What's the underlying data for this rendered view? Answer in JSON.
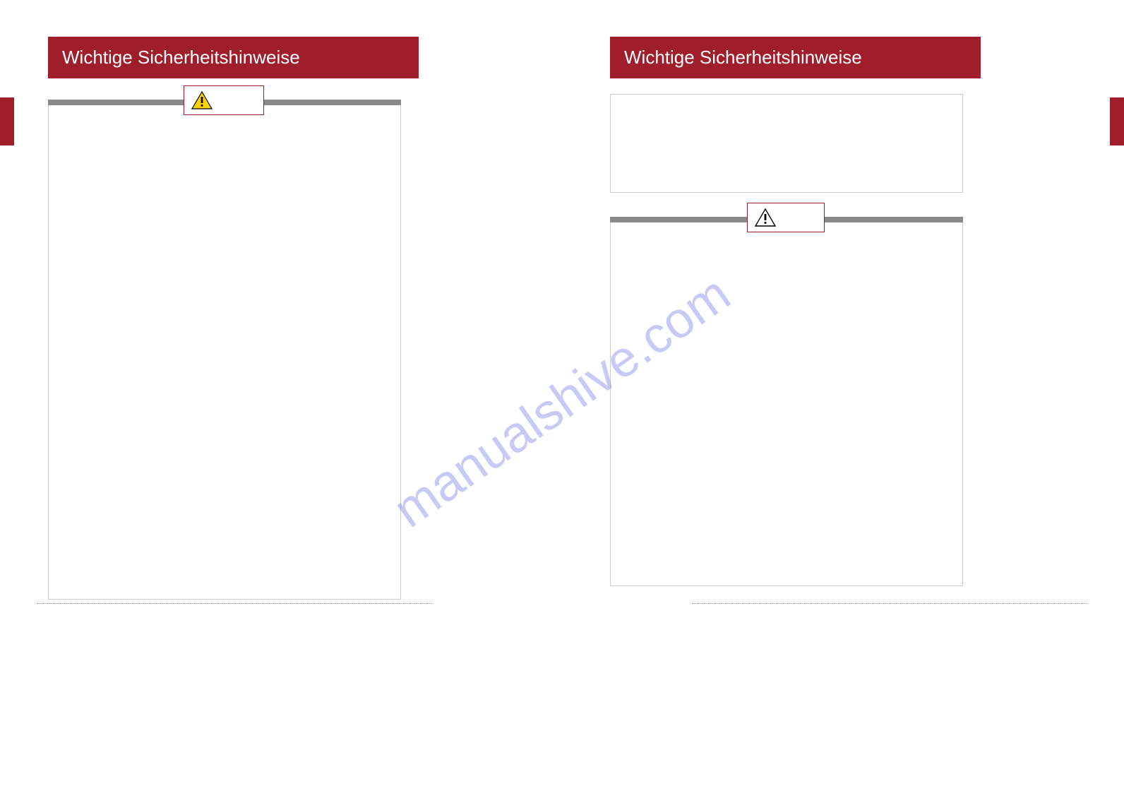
{
  "leftPage": {
    "headerTitle": "Wichtige Sicherheitshinweise",
    "calloutLabel": "",
    "frameContent": ""
  },
  "rightPage": {
    "headerTitle": "Wichtige Sicherheitshinweise",
    "upperFrameContent": "",
    "calloutLabel": "",
    "lowerFrameContent": ""
  },
  "watermarkText": "manualshive.com",
  "icons": {
    "warningYellow": "warning-triangle-yellow",
    "warningOutline": "warning-triangle-outline"
  },
  "colors": {
    "brandRed": "#a01e2c",
    "ruleGray": "#8a8a8a"
  }
}
